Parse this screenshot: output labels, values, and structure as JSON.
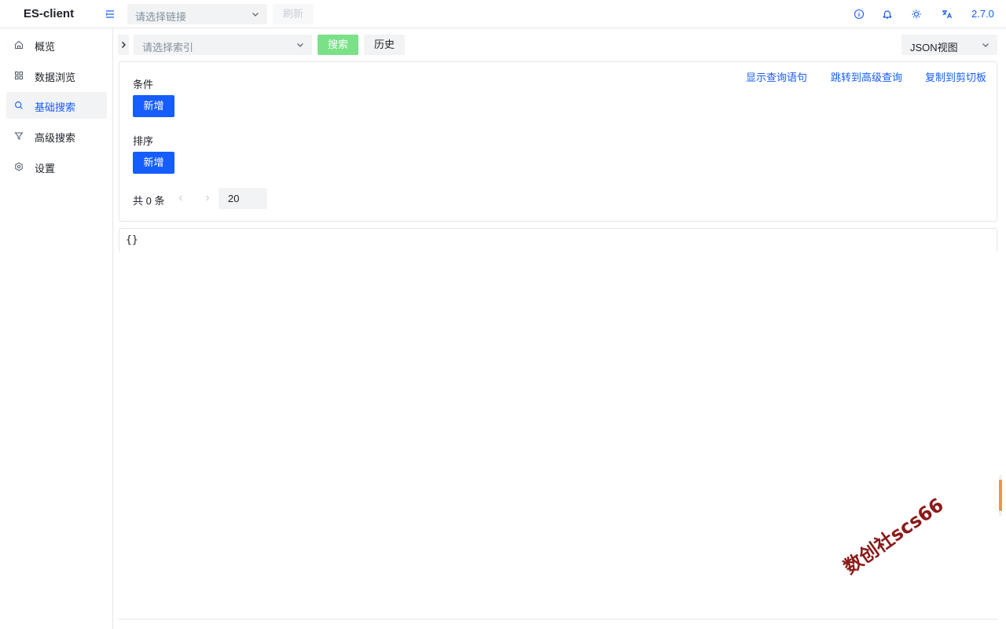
{
  "header": {
    "app_title": "ES-client",
    "connection_placeholder": "请选择链接",
    "refresh_label": "刷新",
    "version": "2.7.0",
    "accent_color": "#165dff"
  },
  "sidebar": {
    "items": [
      {
        "label": "概览",
        "icon": "home-icon",
        "active": false
      },
      {
        "label": "数据浏览",
        "icon": "grid-icon",
        "active": false
      },
      {
        "label": "基础搜索",
        "icon": "search-icon",
        "active": true
      },
      {
        "label": "高级搜索",
        "icon": "filter-icon",
        "active": false
      },
      {
        "label": "设置",
        "icon": "gear-icon",
        "active": false
      }
    ]
  },
  "toolbar": {
    "index_placeholder": "请选择索引",
    "search_label": "搜索",
    "history_label": "历史",
    "view_mode": "JSON视图"
  },
  "query_panel": {
    "links": [
      "显示查询语句",
      "跳转到高级查询",
      "复制到剪切板"
    ],
    "conditions_title": "条件",
    "sort_title": "排序",
    "add_label": "新增",
    "total_text": "共 0 条",
    "page_size": "20"
  },
  "result": {
    "json_text": "{}"
  },
  "watermark": "数创社scs66"
}
